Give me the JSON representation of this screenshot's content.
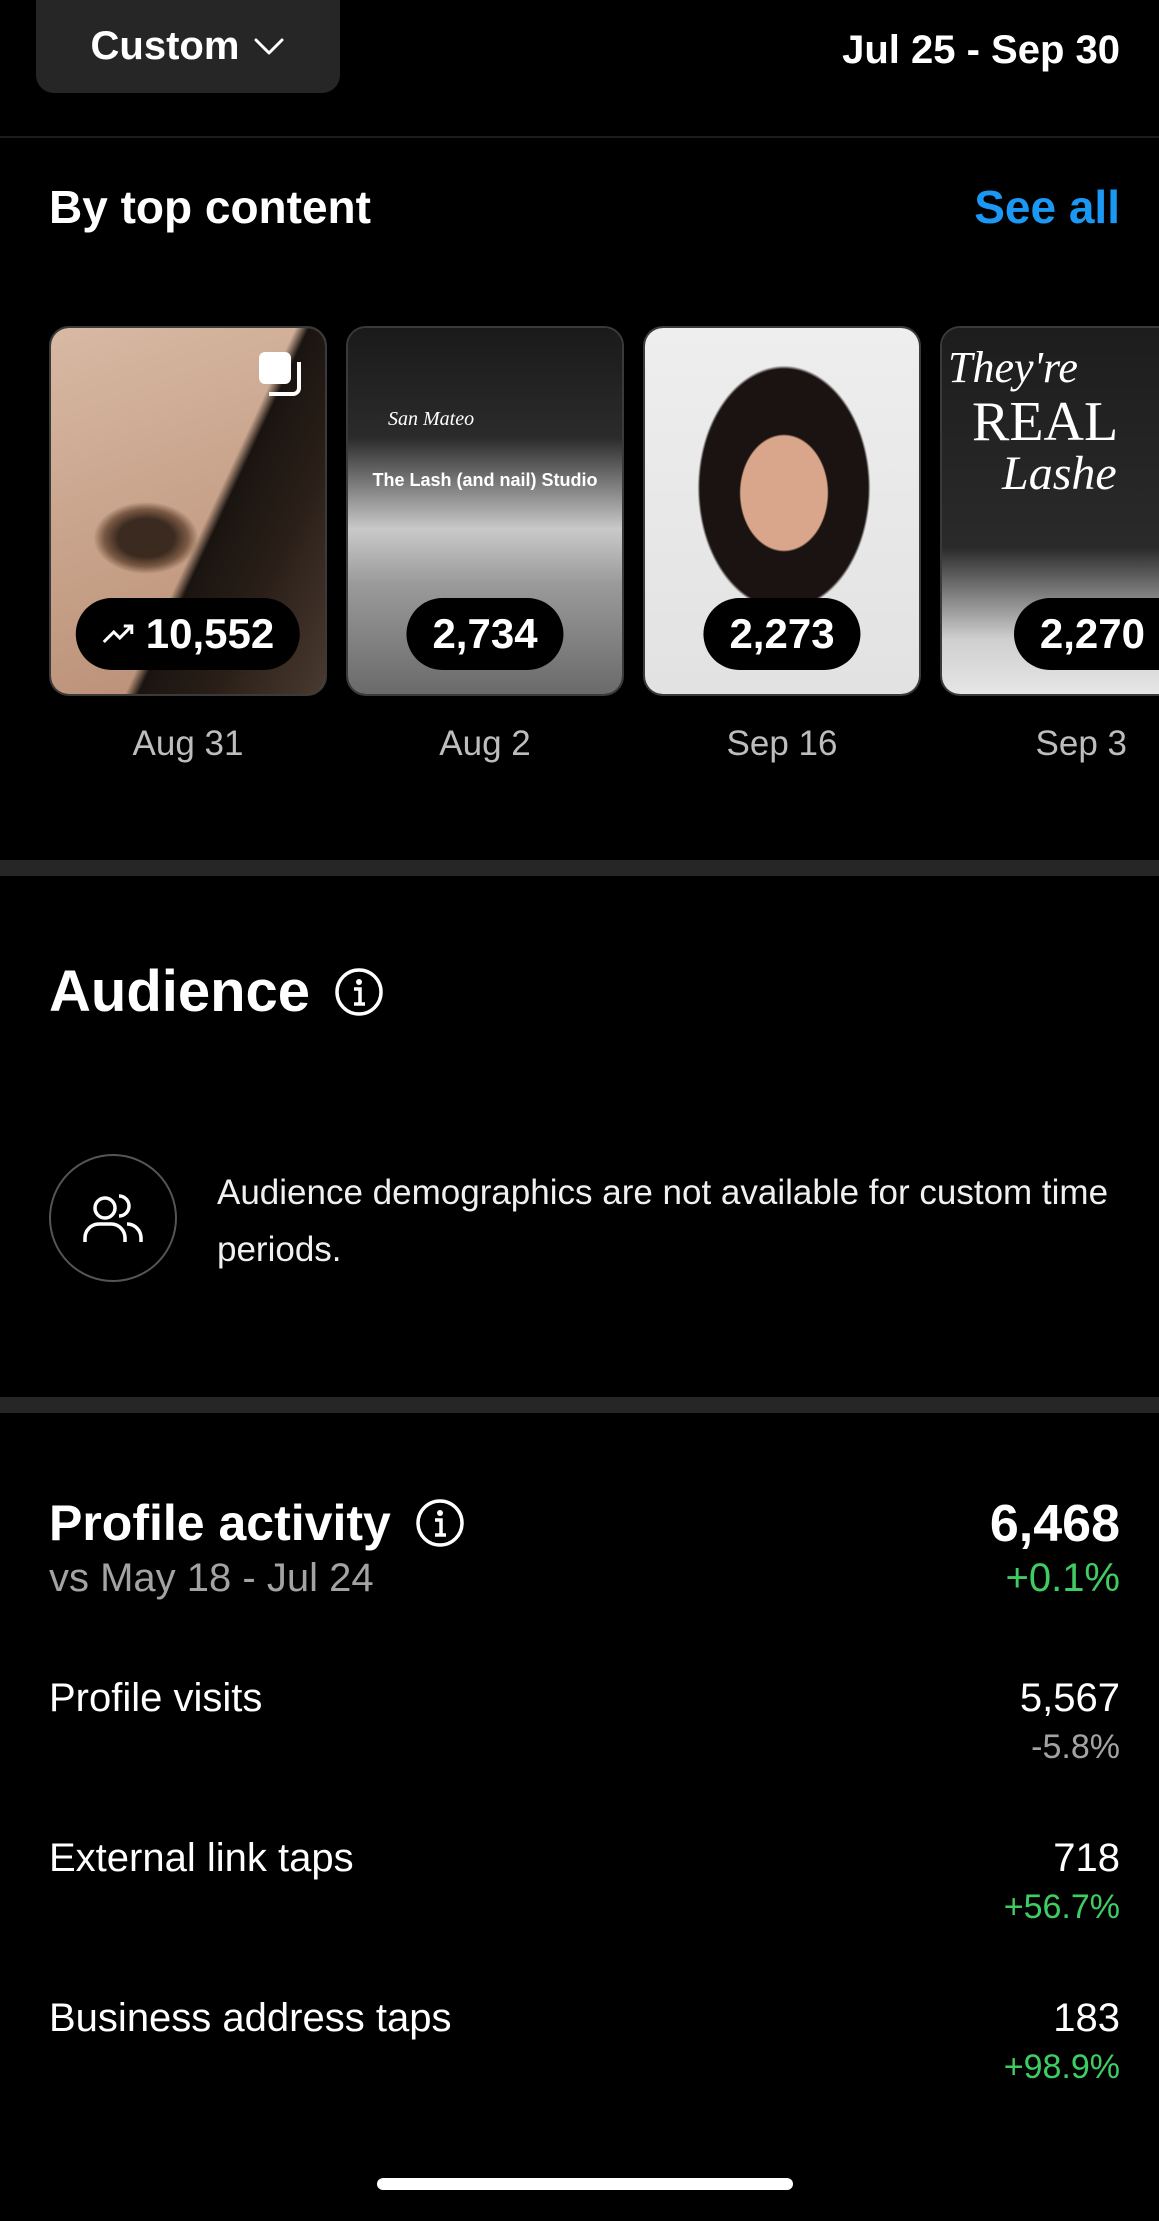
{
  "header": {
    "period_label": "Custom",
    "date_range": "Jul 25 - Sep 30"
  },
  "top_content": {
    "title": "By top content",
    "see_all": "See all",
    "items": [
      {
        "value": "10,552",
        "date": "Aug 31",
        "trending": true,
        "carousel": true
      },
      {
        "value": "2,734",
        "date": "Aug 2",
        "overlay_text": [
          "San Mateo",
          "The Lash (and nail) Studio"
        ]
      },
      {
        "value": "2,273",
        "date": "Sep 16"
      },
      {
        "value": "2,270",
        "date": "Sep 3",
        "overlay_text": [
          "They're",
          "REAL",
          "Lashe"
        ]
      }
    ]
  },
  "audience": {
    "title": "Audience",
    "message": "Audience demographics are not available for custom time periods."
  },
  "profile_activity": {
    "title": "Profile activity",
    "comparison": "vs May 18 - Jul 24",
    "total": "6,468",
    "total_change": "+0.1%",
    "metrics": [
      {
        "label": "Profile visits",
        "value": "5,567",
        "change": "-5.8%",
        "trend": "down"
      },
      {
        "label": "External link taps",
        "value": "718",
        "change": "+56.7%",
        "trend": "up"
      },
      {
        "label": "Business address taps",
        "value": "183",
        "change": "+98.9%",
        "trend": "up"
      }
    ]
  },
  "colors": {
    "background": "#000000",
    "accent_link": "#1a98f3",
    "positive": "#3fcc63",
    "negative": "#a3a3a3"
  }
}
